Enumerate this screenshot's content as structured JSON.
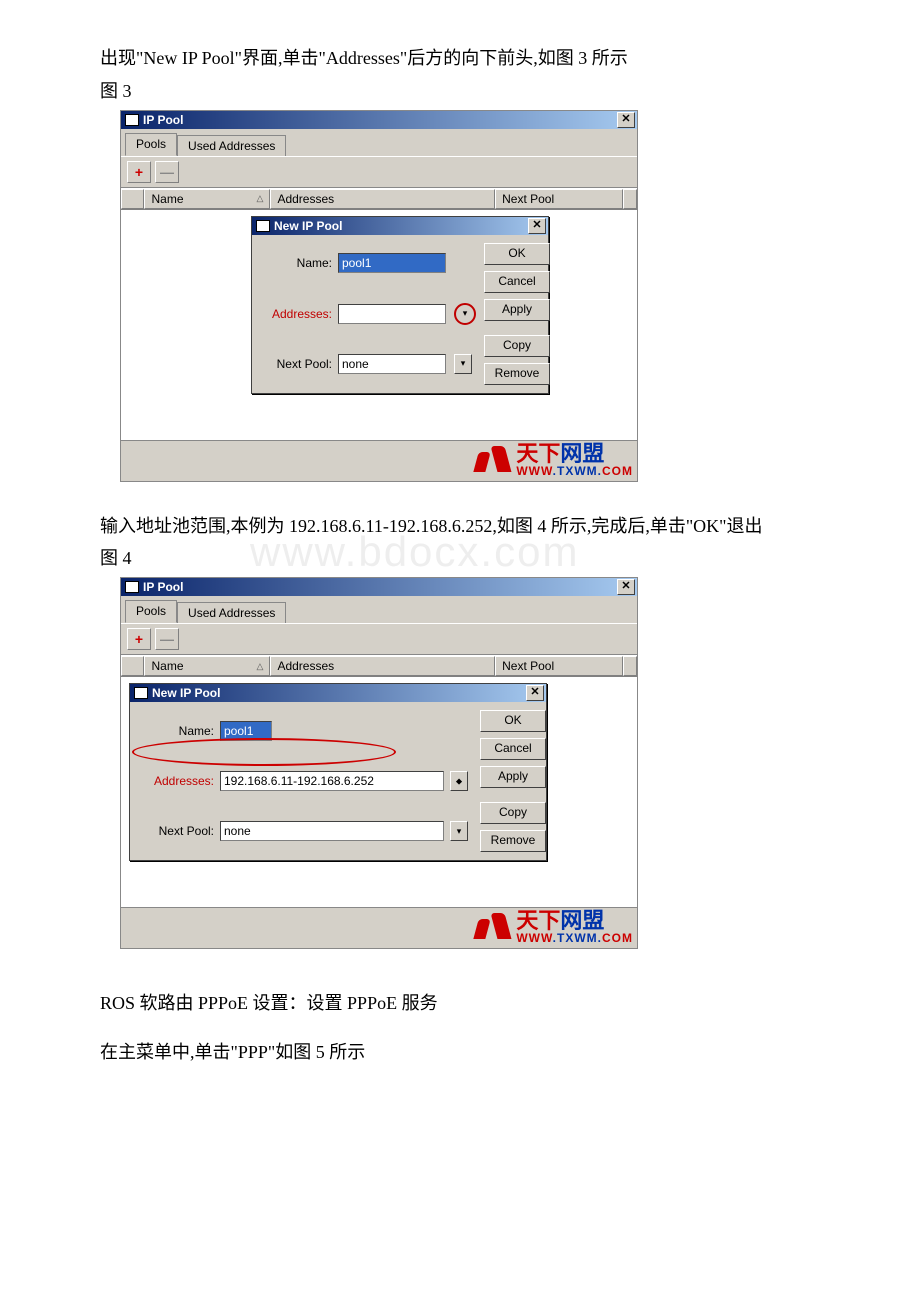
{
  "para1": "出现\"New IP Pool\"界面,单击\"Addresses\"后方的向下前头,如图 3 所示",
  "fig3_label": "图 3",
  "para2": "输入地址池范围,本例为 192.168.6.11-192.168.6.252,如图 4 所示,完成后,单击\"OK\"退出",
  "fig4_label": "图 4",
  "para3": "ROS 软路由 PPPoE 设置：设置 PPPoE 服务",
  "para4": "在主菜单中,单击\"PPP\"如图 5 所示",
  "watermark": "www.bdocx.com",
  "ippool": {
    "title": "IP Pool",
    "tab_pools": "Pools",
    "tab_used": "Used Addresses",
    "col_name": "Name",
    "col_addr": "Addresses",
    "col_next": "Next Pool"
  },
  "dialog": {
    "title": "New IP Pool",
    "label_name": "Name:",
    "label_addr": "Addresses:",
    "label_next": "Next Pool:",
    "name_value": "pool1",
    "next_value": "none",
    "addr_value_fig4": "192.168.6.11-192.168.6.252",
    "btn_ok": "OK",
    "btn_cancel": "Cancel",
    "btn_apply": "Apply",
    "btn_copy": "Copy",
    "btn_remove": "Remove"
  },
  "logo": {
    "cn1": "天下",
    "cn2": "网盟",
    "url_pre": "WWW",
    "url_mid": ".TXWM.",
    "url_post": "COM"
  }
}
